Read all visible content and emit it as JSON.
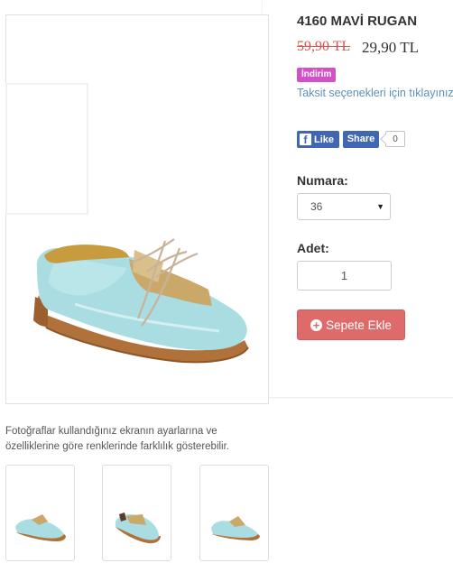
{
  "product": {
    "title": "4160 MAVİ RUGAN",
    "old_price": "59,90 TL",
    "new_price": "29,90 TL",
    "discount_badge": "İndirim",
    "installment_link": "Taksit seçenekleri için tıklayınız"
  },
  "social": {
    "like_label": "Like",
    "share_label": "Share",
    "share_count": "0"
  },
  "size": {
    "label": "Numara:",
    "selected": "36"
  },
  "quantity": {
    "label": "Adet:",
    "value": "1"
  },
  "cart": {
    "button_label": "Sepete Ekle"
  },
  "disclaimer": "Fotoğraflar kullandığınız ekranın ayarlarına ve özelliklerine göre renklerinde farklılık gösterebilir.",
  "colors": {
    "shoe": "#a9dde2",
    "sole": "#b0713a",
    "metal": "#c9a86a",
    "badge": "#d251c8",
    "cart_button": "#df6a6a",
    "link": "#5d91b8",
    "facebook": "#4267b2"
  }
}
